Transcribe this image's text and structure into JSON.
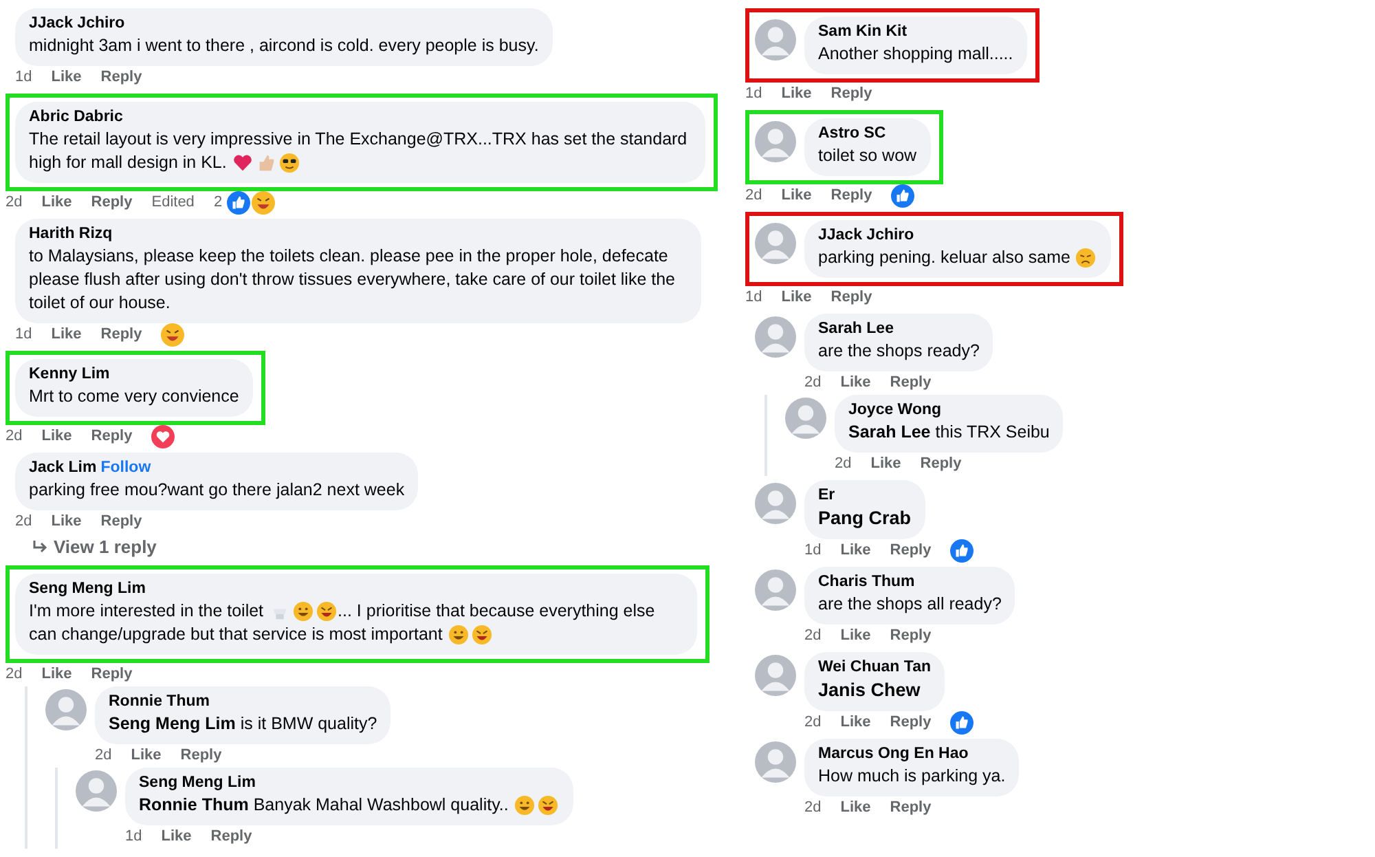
{
  "columns": [
    {
      "comments": [
        {
          "author": "JJack Jchiro",
          "body": [
            {
              "text": "midnight 3am i went to there , aircond is cold. every people is busy."
            }
          ],
          "time": "1d",
          "actions": [
            "Like",
            "Reply"
          ]
        },
        {
          "author": "Abric Dabric",
          "color": "#22dd22",
          "body": [
            {
              "text": "The retail layout is very impressive in The Exchange@TRX...TRX has set the standard"
            },
            {
              "text": "high for mall design in KL."
            },
            {
              "kind": "heart"
            },
            {
              "kind": "thumbs"
            },
            {
              "kind": "cool"
            }
          ],
          "time": "2d",
          "actions": [
            "Like",
            "Reply"
          ],
          "edited": "Edited",
          "reaction_count": "2",
          "reactions": [
            {
              "kind": "like"
            },
            {
              "kind": "haha"
            }
          ]
        },
        {
          "author": "Harith Rizq",
          "body": [
            {
              "text": "to Malaysians, please keep the toilets clean. please pee in the proper hole, defecate please flush after using don't throw tissues everywhere, take care of our toilet like the toilet of our house."
            }
          ],
          "time": "1d",
          "actions": [
            "Like",
            "Reply"
          ],
          "reactions": [
            {
              "kind": "haha"
            }
          ]
        },
        {
          "author": "Kenny Lim",
          "color": "#22dd22",
          "body": [
            {
              "text": "Mrt to come very convience"
            }
          ],
          "time": "2d",
          "actions": [
            "Like",
            "Reply"
          ],
          "reactions": [
            {
              "kind": "love"
            }
          ]
        },
        {
          "author": "Jack Lim",
          "follow": "Follow",
          "body": [
            {
              "text": "parking free mou?want go there jalan2 next week"
            }
          ],
          "time": "2d",
          "actions": [
            "Like",
            "Reply"
          ],
          "view_replies": "View 1 reply"
        },
        {
          "author": "Seng Meng Lim",
          "color": "#22dd22",
          "body": [
            {
              "text": "I'm more interested in the toilet"
            },
            {
              "kind": "toilet"
            },
            {
              "kind": "smile"
            },
            {
              "kind": "rofl"
            },
            {
              "text": "... I prioritise that because everything else"
            },
            {
              "text": "can change/upgrade but that service is most important"
            },
            {
              "kind": "smile"
            },
            {
              "kind": "rofl"
            }
          ],
          "time": "2d",
          "actions": [
            "Like",
            "Reply"
          ],
          "replies": [
            {
              "author": "Ronnie Thum",
              "avatar": true,
              "body": [
                {
                  "text": "**Seng Meng Lim** is it BMW quality?"
                }
              ],
              "time": "2d",
              "actions": [
                "Like",
                "Reply"
              ],
              "replies": [
                {
                  "author": "Seng Meng Lim",
                  "avatar": true,
                  "body": [
                    {
                      "text": "**Ronnie Thum** Banyak Mahal Washbowl quality.."
                    },
                    {
                      "kind": "smile"
                    },
                    {
                      "kind": "rofl"
                    }
                  ],
                  "time": "1d",
                  "actions": [
                    "Like",
                    "Reply"
                  ]
                }
              ]
            }
          ]
        }
      ]
    },
    {
      "comments": [
        {
          "author": "Sam Kin Kit",
          "avatar": true,
          "color": "#dd1111",
          "body": [
            {
              "text": "Another shopping mall....."
            }
          ],
          "time": "1d",
          "actions": [
            "Like",
            "Reply"
          ]
        },
        {
          "author": "Astro SC",
          "avatar": true,
          "color": "#22dd22",
          "body": [
            {
              "text": "toilet so wow"
            }
          ],
          "time": "2d",
          "actions": [
            "Like",
            "Reply"
          ],
          "reactions": [
            {
              "kind": "like"
            }
          ]
        },
        {
          "author": "JJack Jchiro",
          "avatar": true,
          "color": "#dd1111",
          "body": [
            {
              "text": "parking pening. keluar also same"
            },
            {
              "kind": "sad"
            }
          ],
          "time": "1d",
          "actions": [
            "Like",
            "Reply"
          ]
        },
        {
          "author": "Sarah Lee",
          "avatar": true,
          "body": [
            {
              "text": "are the shops ready?"
            }
          ],
          "time": "2d",
          "actions": [
            "Like",
            "Reply"
          ],
          "replies": [
            {
              "author": "Joyce Wong",
              "avatar": true,
              "body": [
                {
                  "text": "**Sarah Lee** this TRX Seibu"
                }
              ],
              "time": "2d",
              "actions": [
                "Like",
                "Reply"
              ]
            }
          ]
        },
        {
          "author": "Er",
          "avatar": true,
          "body": [
            {
              "text": "Pang Crab",
              "tagged": true
            }
          ],
          "time": "1d",
          "actions": [
            "Like",
            "Reply"
          ],
          "reactions": [
            {
              "kind": "like"
            }
          ]
        },
        {
          "author": "Charis Thum",
          "avatar": true,
          "body": [
            {
              "text": "are the shops all ready?"
            }
          ],
          "time": "2d",
          "actions": [
            "Like",
            "Reply"
          ]
        },
        {
          "author": "Wei Chuan Tan",
          "avatar": true,
          "body": [
            {
              "text": "Janis Chew",
              "tagged": true
            }
          ],
          "time": "2d",
          "actions": [
            "Like",
            "Reply"
          ],
          "reactions": [
            {
              "kind": "like"
            }
          ]
        },
        {
          "author": "Marcus Ong En Hao",
          "avatar": true,
          "body": [
            {
              "text": "How much is parking ya."
            }
          ],
          "time": "2d",
          "actions": [
            "Like",
            "Reply"
          ]
        }
      ]
    }
  ]
}
